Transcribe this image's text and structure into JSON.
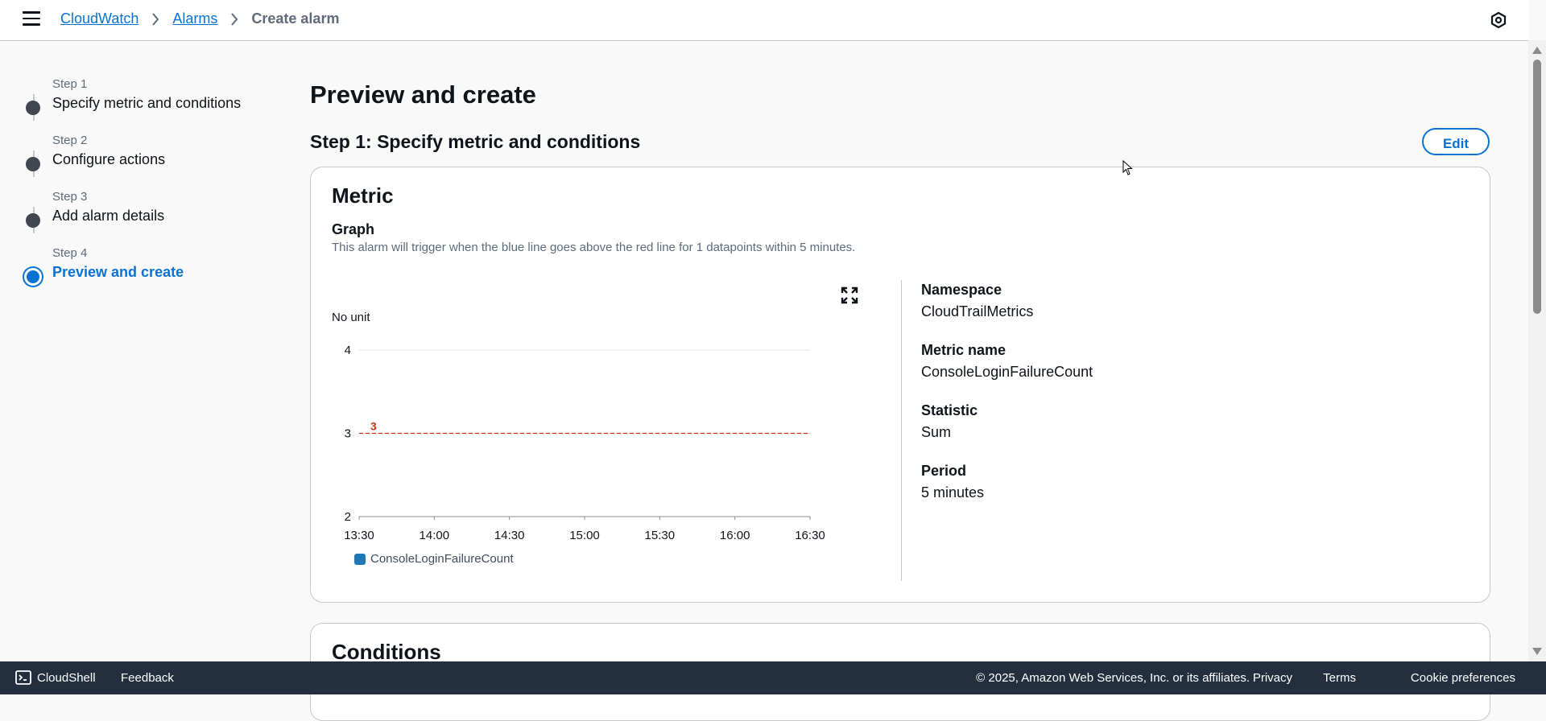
{
  "header": {
    "breadcrumbs": [
      {
        "label": "CloudWatch"
      },
      {
        "label": "Alarms"
      }
    ],
    "current": "Create alarm"
  },
  "steps": [
    {
      "num": "Step 1",
      "title": "Specify metric and conditions",
      "state": "complete"
    },
    {
      "num": "Step 2",
      "title": "Configure actions",
      "state": "complete"
    },
    {
      "num": "Step 3",
      "title": "Add alarm details",
      "state": "complete"
    },
    {
      "num": "Step 4",
      "title": "Preview and create",
      "state": "active"
    }
  ],
  "main": {
    "page_title": "Preview and create",
    "section_title": "Step 1: Specify metric and conditions",
    "edit_label": "Edit",
    "metric_card": {
      "title": "Metric",
      "graph_label": "Graph",
      "graph_description": "This alarm will trigger when the blue line goes above the red line for 1 datapoints within 5 minutes.",
      "unit_label": "No unit",
      "details": [
        {
          "key": "Namespace",
          "value": "CloudTrailMetrics"
        },
        {
          "key": "Metric name",
          "value": "ConsoleLoginFailureCount"
        },
        {
          "key": "Statistic",
          "value": "Sum"
        },
        {
          "key": "Period",
          "value": "5 minutes"
        }
      ]
    },
    "conditions_card": {
      "title": "Conditions"
    }
  },
  "chart_data": {
    "type": "line",
    "x_ticks": [
      "13:30",
      "14:00",
      "14:30",
      "15:00",
      "15:30",
      "16:00",
      "16:30"
    ],
    "y_ticks": [
      4,
      3,
      2
    ],
    "ylim": [
      2,
      4
    ],
    "threshold": {
      "value": 3,
      "label": "3",
      "color": "#d13212"
    },
    "series": [
      {
        "name": "ConsoleLoginFailureCount",
        "color": "#1f77b4",
        "values": []
      }
    ],
    "grid": true,
    "legend_position": "bottom-left"
  },
  "footer": {
    "cloudshell": "CloudShell",
    "feedback": "Feedback",
    "copyright": "© 2025, Amazon Web Services, Inc. or its affiliates.",
    "privacy": "Privacy",
    "terms": "Terms",
    "cookies": "Cookie preferences"
  },
  "icons": {
    "menu": "hamburger-icon",
    "settings": "settings-icon",
    "expand": "expand-icon",
    "cloudshell": "terminal-icon",
    "separator": "chevron-right-icon"
  },
  "colors": {
    "link": "#0972d3",
    "footer_bg": "#232f3e",
    "threshold": "#d13212",
    "series": "#1f77b4"
  }
}
